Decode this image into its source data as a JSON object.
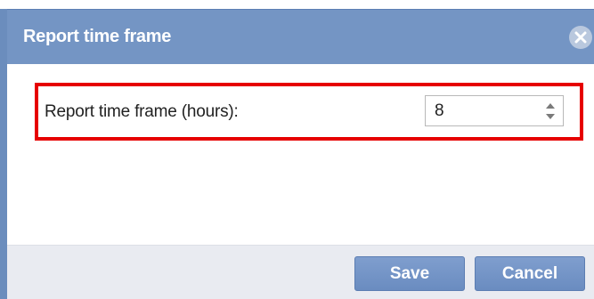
{
  "dialog": {
    "title": "Report time frame",
    "close_icon": "close-icon"
  },
  "field": {
    "label": "Report time frame (hours):",
    "value": "8",
    "arrows_icon": "spinner-arrows-icon"
  },
  "footer": {
    "save_label": "Save",
    "cancel_label": "Cancel"
  },
  "colors": {
    "titlebar": "#7495c4",
    "highlight": "#e60000",
    "button": "#7393c6"
  }
}
